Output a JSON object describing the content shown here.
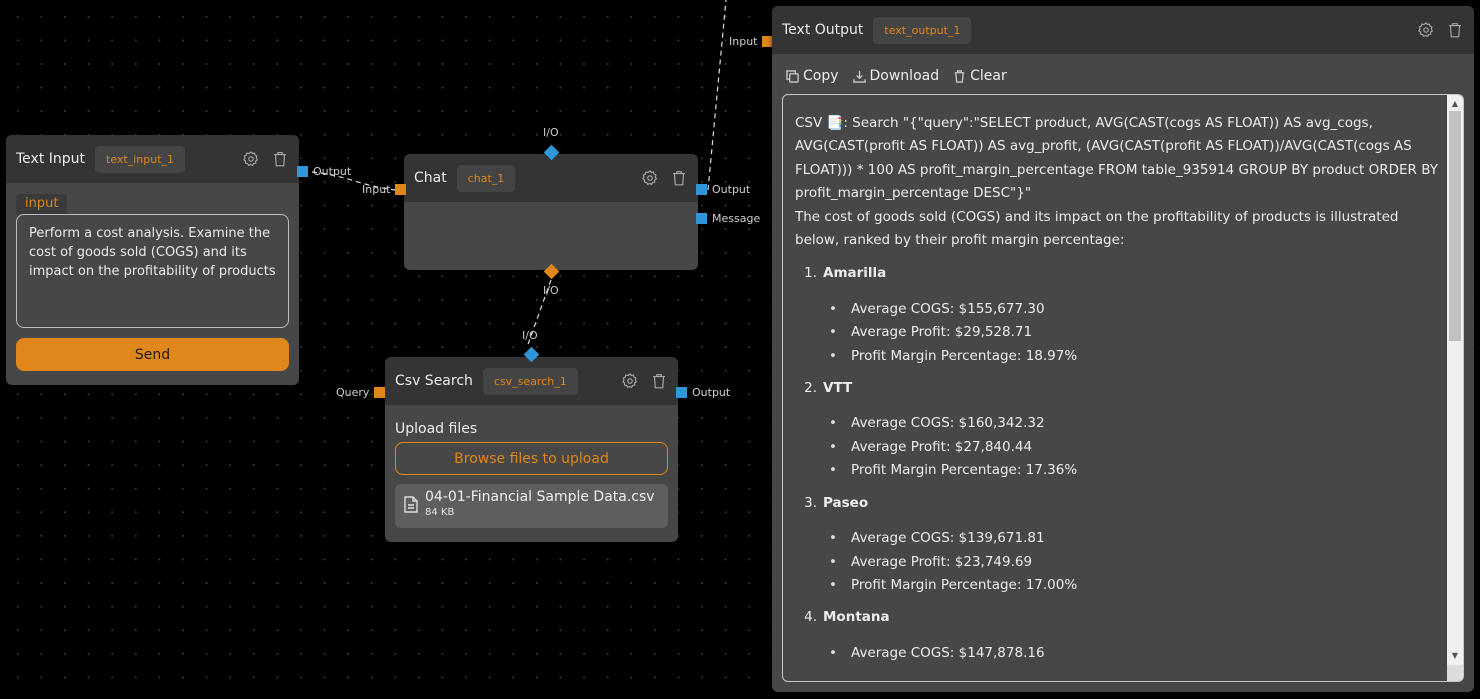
{
  "nodes": {
    "text_input": {
      "title": "Text Input",
      "id": "text_input_1",
      "field_label": "input",
      "value": "Perform a cost analysis. Examine the cost of goods sold (COGS) and its impact on the profitability of products",
      "send_label": "Send",
      "ports": {
        "output": "Output"
      }
    },
    "chat": {
      "title": "Chat",
      "id": "chat_1",
      "ports": {
        "input": "Input",
        "output": "Output",
        "message": "Message",
        "io_top": "I/O",
        "io_bottom": "I/O"
      }
    },
    "csv_search": {
      "title": "Csv Search",
      "id": "csv_search_1",
      "upload_label": "Upload files",
      "browse_label": "Browse files to upload",
      "file": {
        "name": "04-01-Financial Sample Data.csv",
        "size": "84 KB"
      },
      "ports": {
        "query": "Query",
        "output": "Output",
        "io_top": "I/O"
      }
    },
    "text_output": {
      "title": "Text Output",
      "id": "text_output_1",
      "ports": {
        "input": "Input"
      },
      "toolbar": {
        "copy": "Copy",
        "download": "Download",
        "clear": "Clear"
      },
      "content": {
        "search_line": "CSV 📑: Search \"{\"query\":\"SELECT product, AVG(CAST(cogs AS FLOAT)) AS avg_cogs, AVG(CAST(profit AS FLOAT)) AS avg_profit, (AVG(CAST(profit AS FLOAT))/AVG(CAST(cogs AS FLOAT))) * 100 AS profit_margin_percentage FROM table_935914 GROUP BY product ORDER BY profit_margin_percentage DESC\"}\"",
        "intro": "The cost of goods sold (COGS) and its impact on the profitability of products is illustrated below, ranked by their profit margin percentage:",
        "products": [
          {
            "num": "1.",
            "name": "Amarilla",
            "metrics": [
              "Average COGS: $155,677.30",
              "Average Profit: $29,528.71",
              "Profit Margin Percentage: 18.97%"
            ]
          },
          {
            "num": "2.",
            "name": "VTT",
            "metrics": [
              "Average COGS: $160,342.32",
              "Average Profit: $27,840.44",
              "Profit Margin Percentage: 17.36%"
            ]
          },
          {
            "num": "3.",
            "name": "Paseo",
            "metrics": [
              "Average COGS: $139,671.81",
              "Average Profit: $23,749.69",
              "Profit Margin Percentage: 17.00%"
            ]
          },
          {
            "num": "4.",
            "name": "Montana",
            "metrics": [
              "Average COGS: $147,878.16"
            ]
          }
        ]
      }
    }
  },
  "colors": {
    "accent": "#e0861a",
    "port_blue": "#2f96d7",
    "canvas": "#000000",
    "node_body": "#474747",
    "node_header": "#343434"
  }
}
